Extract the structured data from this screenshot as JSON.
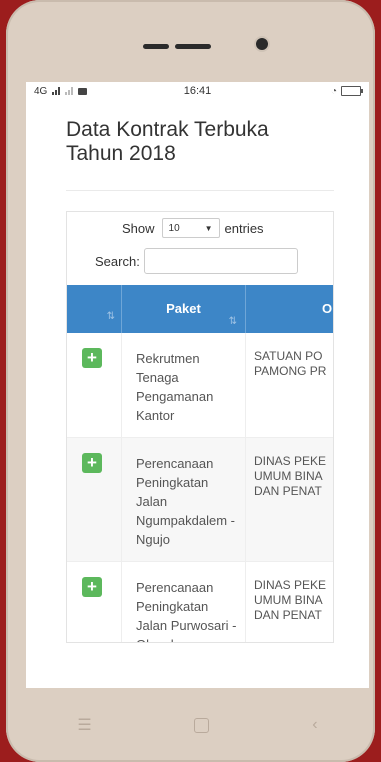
{
  "status_bar": {
    "network_label": "4G",
    "time": "16:41"
  },
  "page": {
    "title": "Data Kontrak Terbuka Tahun 2018"
  },
  "controls": {
    "show_label": "Show",
    "entries_value": "10",
    "entries_label": "entries",
    "search_label": "Search:"
  },
  "table": {
    "headers": [
      "",
      "Paket",
      "O"
    ],
    "rows": [
      {
        "paket": "Rekrutmen Tenaga Pengamanan Kantor",
        "op_line1": "SATUAN PO",
        "op_line2": "PAMONG PR",
        "op_line3": ""
      },
      {
        "paket": "Perencanaan Peningkatan Jalan Ngumpakdalem - Ngujo",
        "op_line1": "DINAS PEKE",
        "op_line2": "UMUM BINA",
        "op_line3": "DAN PENAT"
      },
      {
        "paket": "Perencanaan Peningkatan Jalan Purwosari - Glagah",
        "op_line1": "DINAS PEKE",
        "op_line2": "UMUM BINA",
        "op_line3": "DAN PENAT"
      }
    ],
    "expand_symbol": "+"
  },
  "icons": {
    "sort": "sort-icon",
    "expand": "plus-icon",
    "nav_menu": "menu-icon",
    "nav_home": "home-icon",
    "nav_back": "back-icon"
  },
  "colors": {
    "header_bg": "#3d86c7",
    "expand_btn": "#5cb85c",
    "device_bg": "#9c1d1d"
  }
}
